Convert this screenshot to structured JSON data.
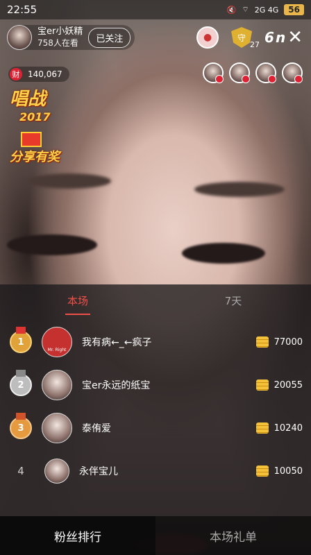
{
  "status_bar": {
    "time": "22:55",
    "network": "2G 4G",
    "battery": "56"
  },
  "host": {
    "name": "宝er小妖精",
    "viewers": "758人在看",
    "follow_label": "已关注"
  },
  "top_right": {
    "shield_count": "27",
    "brand": "6 n"
  },
  "coins": {
    "icon_text": "财",
    "value": "140,067"
  },
  "promos": {
    "line1": "唱战",
    "year": "2017",
    "line2": "分享有奖"
  },
  "leaderboard": {
    "tabs": [
      {
        "label": "本场"
      },
      {
        "label": "7天"
      }
    ],
    "rows": [
      {
        "rank": "1",
        "name": "我有病←_←疯子",
        "score": "77000",
        "avatar_text": "Mr. Right"
      },
      {
        "rank": "2",
        "name": "宝er永远的纸宝",
        "score": "20055"
      },
      {
        "rank": "3",
        "name": "泰侑爱",
        "score": "10240"
      },
      {
        "rank": "4",
        "name": "永伴宝儿",
        "score": "10050"
      }
    ]
  },
  "bottom_tabs": [
    {
      "label": "粉丝排行"
    },
    {
      "label": "本场礼单"
    }
  ],
  "colors": {
    "accent": "#f0504a",
    "gold": "#e2a23a"
  }
}
